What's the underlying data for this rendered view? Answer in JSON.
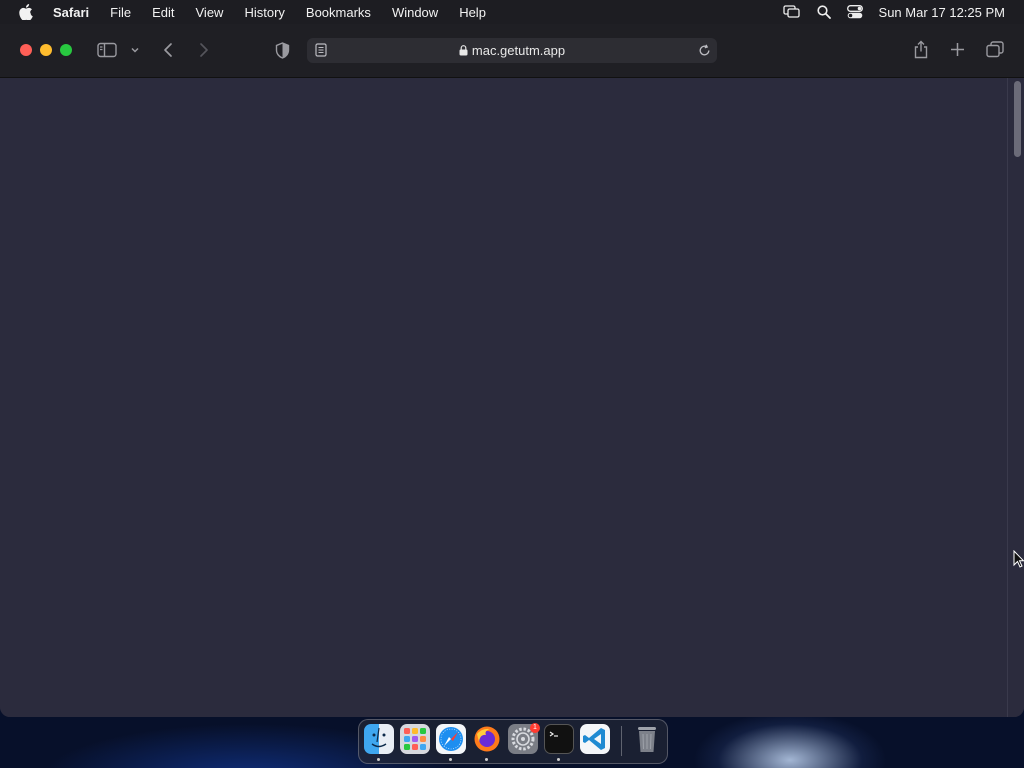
{
  "menubar": {
    "app_name": "Safari",
    "items": [
      "File",
      "Edit",
      "View",
      "History",
      "Bookmarks",
      "Window",
      "Help"
    ],
    "clock": "Sun Mar 17  12:25 PM",
    "status_icons": [
      "screen-mirroring-icon",
      "spotlight-search-icon",
      "control-center-icon"
    ]
  },
  "browser": {
    "address": {
      "url": "mac.getutm.app",
      "secure": true
    },
    "toolbar_icons": [
      "sidebar-icon",
      "chevron-down-icon",
      "back-icon",
      "forward-icon",
      "privacy-shield-icon",
      "reader-icon",
      "reload-icon",
      "share-icon",
      "new-tab-icon",
      "tab-overview-icon"
    ],
    "page_background": "#2b2b3d"
  },
  "dock": {
    "apps": [
      {
        "name": "Finder",
        "running": true
      },
      {
        "name": "Launchpad",
        "running": false
      },
      {
        "name": "Safari",
        "running": true
      },
      {
        "name": "Firefox",
        "running": true
      },
      {
        "name": "System Settings",
        "running": false,
        "badge": "1"
      },
      {
        "name": "Terminal",
        "running": true
      },
      {
        "name": "Visual Studio Code",
        "running": false
      },
      {
        "name": "Trash",
        "running": false
      }
    ]
  },
  "colors": {
    "close": "#fe5f57",
    "minimize": "#febc2e",
    "zoom": "#28c840",
    "menubar": "#1d1d22",
    "toolbar": "#1f1f24"
  }
}
